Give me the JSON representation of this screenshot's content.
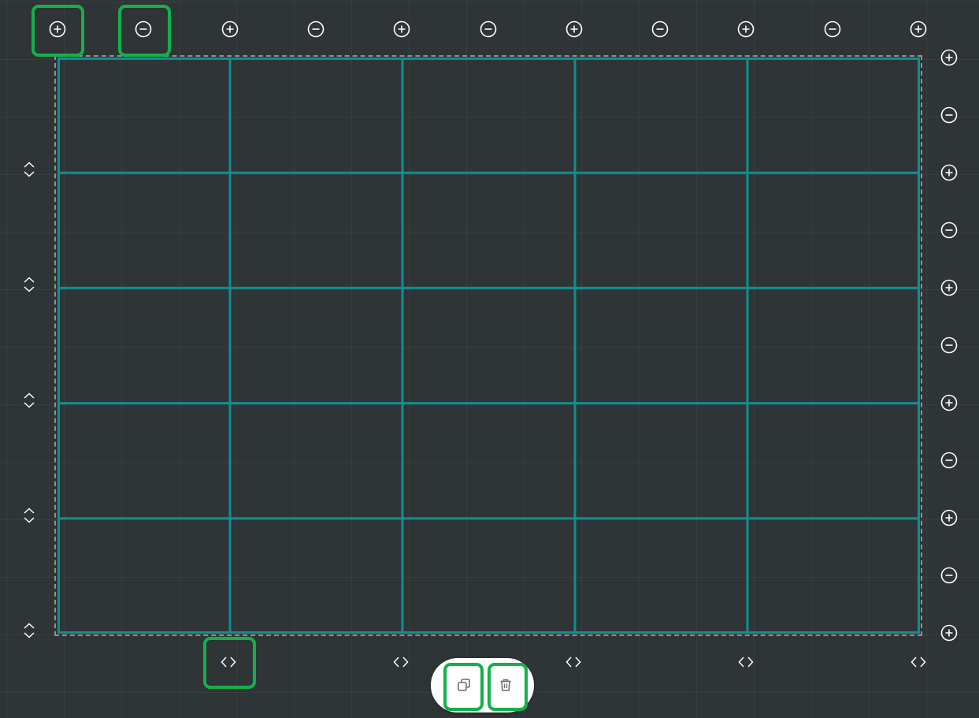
{
  "table": {
    "rows": 5,
    "columns": 5
  },
  "colors": {
    "background": "#2f3436",
    "table_line": "#0f8f8f",
    "frame_border": "#8c9192",
    "control_icon": "#ffffff",
    "highlight": "#14b04b",
    "action_bar": "#ffffff",
    "action_icon": "#6f6f6f"
  },
  "controls": {
    "column_controls": [
      {
        "icon": "add-column-icon"
      },
      {
        "icon": "remove-column-icon"
      },
      {
        "icon": "add-column-icon"
      },
      {
        "icon": "remove-column-icon"
      },
      {
        "icon": "add-column-icon"
      },
      {
        "icon": "remove-column-icon"
      },
      {
        "icon": "add-column-icon"
      },
      {
        "icon": "remove-column-icon"
      },
      {
        "icon": "add-column-icon"
      },
      {
        "icon": "remove-column-icon"
      },
      {
        "icon": "add-column-icon"
      }
    ],
    "row_controls": [
      {
        "icon": "add-row-icon"
      },
      {
        "icon": "remove-row-icon"
      },
      {
        "icon": "add-row-icon"
      },
      {
        "icon": "remove-row-icon"
      },
      {
        "icon": "add-row-icon"
      },
      {
        "icon": "remove-row-icon"
      },
      {
        "icon": "add-row-icon"
      },
      {
        "icon": "remove-row-icon"
      },
      {
        "icon": "add-row-icon"
      },
      {
        "icon": "remove-row-icon"
      },
      {
        "icon": "add-row-icon"
      }
    ],
    "row_resize_handles": 5,
    "column_resize_handles": 5
  },
  "action_bar": {
    "buttons": [
      {
        "name": "duplicate-button",
        "icon": "copy-icon"
      },
      {
        "name": "delete-button",
        "icon": "trash-icon"
      }
    ]
  }
}
